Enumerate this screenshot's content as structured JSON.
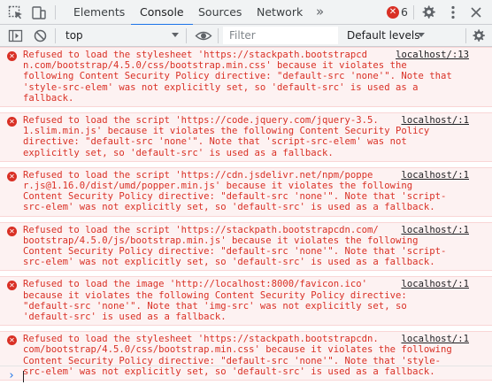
{
  "tabs": [
    {
      "label": "Elements"
    },
    {
      "label": "Console"
    },
    {
      "label": "Sources"
    },
    {
      "label": "Network"
    }
  ],
  "more_tabs_glyph": "»",
  "error_count": "6",
  "toolbar": {
    "context": "top",
    "filter_placeholder": "Filter",
    "levels": "Default levels"
  },
  "messages": [
    {
      "lines": [
        "Refused to load the stylesheet 'https://stackpath.bootstrapcd",
        "n.com/bootstrap/4.5.0/css/bootstrap.min.css' because it violates the",
        "following Content Security Policy directive: \"default-src 'none'\". Note that",
        "'style-src-elem' was not explicitly set, so 'default-src' is used as a",
        "fallback."
      ],
      "source": "localhost/:13"
    },
    {
      "lines": [
        "Refused to load the script 'https://code.jquery.com/jquery-3.5.",
        "1.slim.min.js' because it violates the following Content Security Policy",
        "directive: \"default-src 'none'\". Note that 'script-src-elem' was not",
        "explicitly set, so 'default-src' is used as a fallback."
      ],
      "source": "localhost/:1"
    },
    {
      "lines": [
        "Refused to load the script 'https://cdn.jsdelivr.net/npm/poppe",
        "r.js@1.16.0/dist/umd/popper.min.js' because it violates the following",
        "Content Security Policy directive: \"default-src 'none'\". Note that 'script-",
        "src-elem' was not explicitly set, so 'default-src' is used as a fallback."
      ],
      "source": "localhost/:1"
    },
    {
      "lines": [
        "Refused to load the script 'https://stackpath.bootstrapcdn.com/",
        "bootstrap/4.5.0/js/bootstrap.min.js' because it violates the following",
        "Content Security Policy directive: \"default-src 'none'\". Note that 'script-",
        "src-elem' was not explicitly set, so 'default-src' is used as a fallback."
      ],
      "source": "localhost/:1"
    },
    {
      "lines": [
        "Refused to load the image 'http://localhost:8000/favicon.ico'",
        "because it violates the following Content Security Policy directive:",
        "\"default-src 'none'\". Note that 'img-src' was not explicitly set, so",
        "'default-src' is used as a fallback."
      ],
      "source": "localhost/:1"
    },
    {
      "lines": [
        "Refused to load the stylesheet 'https://stackpath.bootstrapcdn.",
        "com/bootstrap/4.5.0/css/bootstrap.min.css' because it violates the following",
        "Content Security Policy directive: \"default-src 'none'\". Note that 'style-",
        "src-elem' was not explicitly set, so 'default-src' is used as a fallback."
      ],
      "source": "localhost/:1"
    }
  ],
  "prompt_glyph": "›",
  "colors": {
    "error_red": "#d93025",
    "error_bg": "#fdf2f2",
    "accent_blue": "#1a73e8",
    "toolbar_bg": "#f1f3f4"
  }
}
